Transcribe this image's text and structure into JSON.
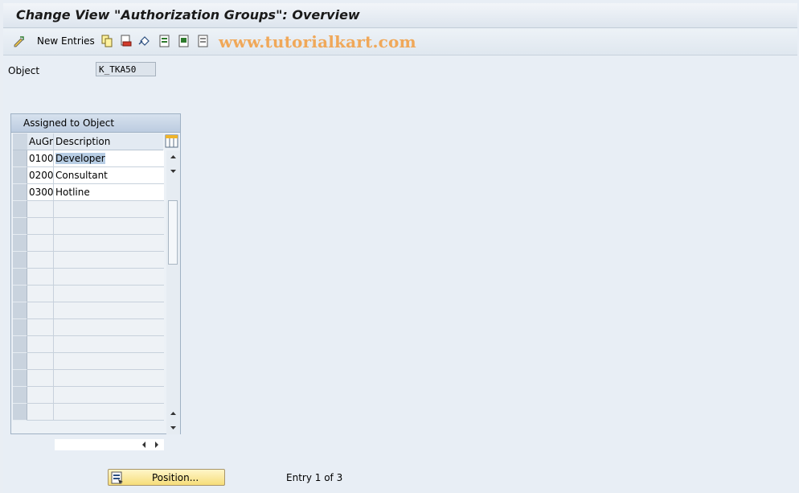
{
  "window": {
    "title": "Change View \"Authorization Groups\": Overview"
  },
  "toolbar": {
    "new_entries_label": "New Entries",
    "icons": [
      "display-change-icon",
      "copy-icon",
      "delete-icon",
      "undo-icon",
      "select-all-icon",
      "select-block-icon",
      "deselect-all-icon"
    ],
    "watermark": "www.tutorialkart.com"
  },
  "object_field": {
    "label": "Object",
    "value": "K_TKA50"
  },
  "table": {
    "title": "Assigned to Object",
    "columns": [
      "AuGr",
      "Description"
    ],
    "rows": [
      {
        "augr": "0100",
        "description": "Developer"
      },
      {
        "augr": "0200",
        "description": "Consultant"
      },
      {
        "augr": "0300",
        "description": "Hotline"
      }
    ]
  },
  "footer": {
    "position_button_label": "Position...",
    "entry_info": "Entry 1 of 3"
  }
}
